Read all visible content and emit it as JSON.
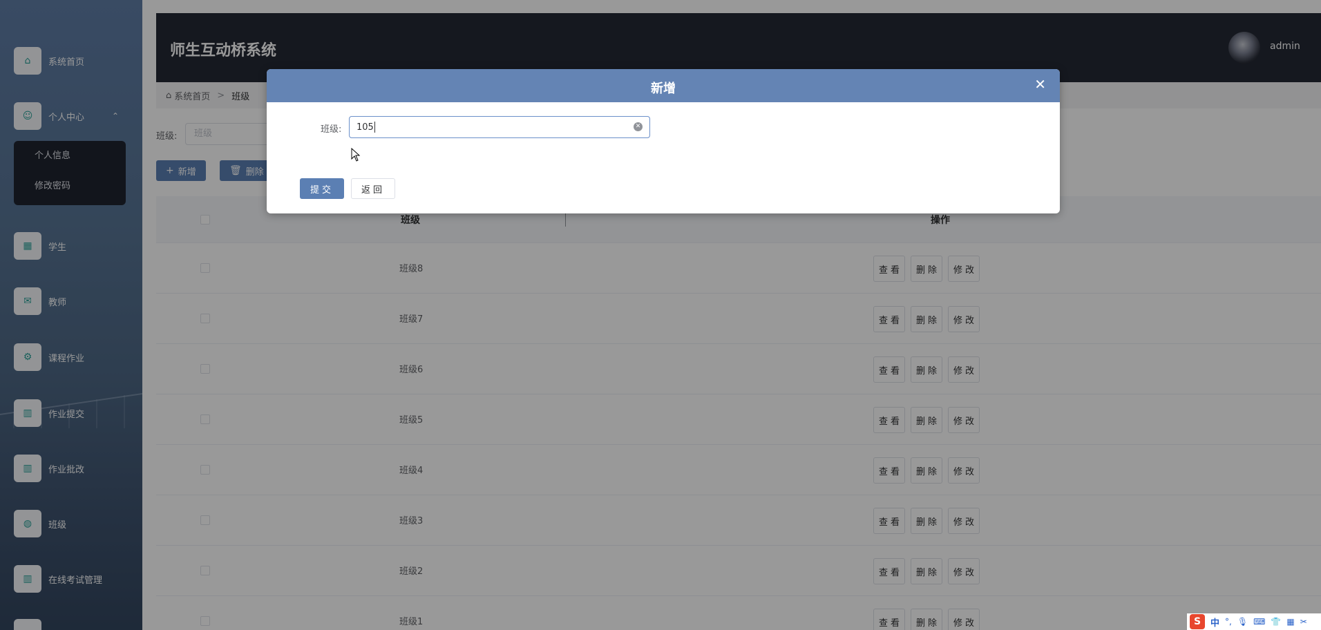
{
  "app": {
    "title": "师生互动桥系统",
    "username": "admin"
  },
  "sidebar": {
    "items": [
      {
        "label": "系统首页",
        "icon": "home-icon"
      },
      {
        "label": "个人中心",
        "icon": "user-icon",
        "caret": "⌃"
      },
      {
        "label": "学生",
        "icon": "grid-icon"
      },
      {
        "label": "教师",
        "icon": "mail-icon"
      },
      {
        "label": "课程作业",
        "icon": "gear-icon"
      },
      {
        "label": "作业提交",
        "icon": "chart-icon"
      },
      {
        "label": "作业批改",
        "icon": "chart-icon"
      },
      {
        "label": "班级",
        "icon": "globe-icon"
      },
      {
        "label": "在线考试管理",
        "icon": "chart-icon"
      }
    ],
    "submenu": [
      {
        "label": "个人信息"
      },
      {
        "label": "修改密码"
      }
    ]
  },
  "breadcrumb": {
    "home": "系统首页",
    "separator": ">",
    "current": "班级"
  },
  "search": {
    "label": "班级:",
    "placeholder": "班级"
  },
  "toolbar": {
    "add_label": "新增",
    "delete_label": "删除"
  },
  "table": {
    "columns": [
      "班级",
      "操作"
    ],
    "rows": [
      {
        "name": "班级8"
      },
      {
        "name": "班级7"
      },
      {
        "name": "班级6"
      },
      {
        "name": "班级5"
      },
      {
        "name": "班级4"
      },
      {
        "name": "班级3"
      },
      {
        "name": "班级2"
      },
      {
        "name": "班级1"
      }
    ],
    "actions": {
      "view": "查看",
      "delete": "删除",
      "edit": "修改"
    }
  },
  "dialog": {
    "title": "新增",
    "close": "✕",
    "field_label": "班级:",
    "field_value": "105",
    "submit_label": "提交",
    "back_label": "返回"
  },
  "ime": {
    "logo": "S",
    "mode": "中",
    "punct": "°,"
  },
  "colors": {
    "header_bg": "#242835",
    "accent": "#5b7fb3",
    "dialog_header": "#6484b4"
  }
}
